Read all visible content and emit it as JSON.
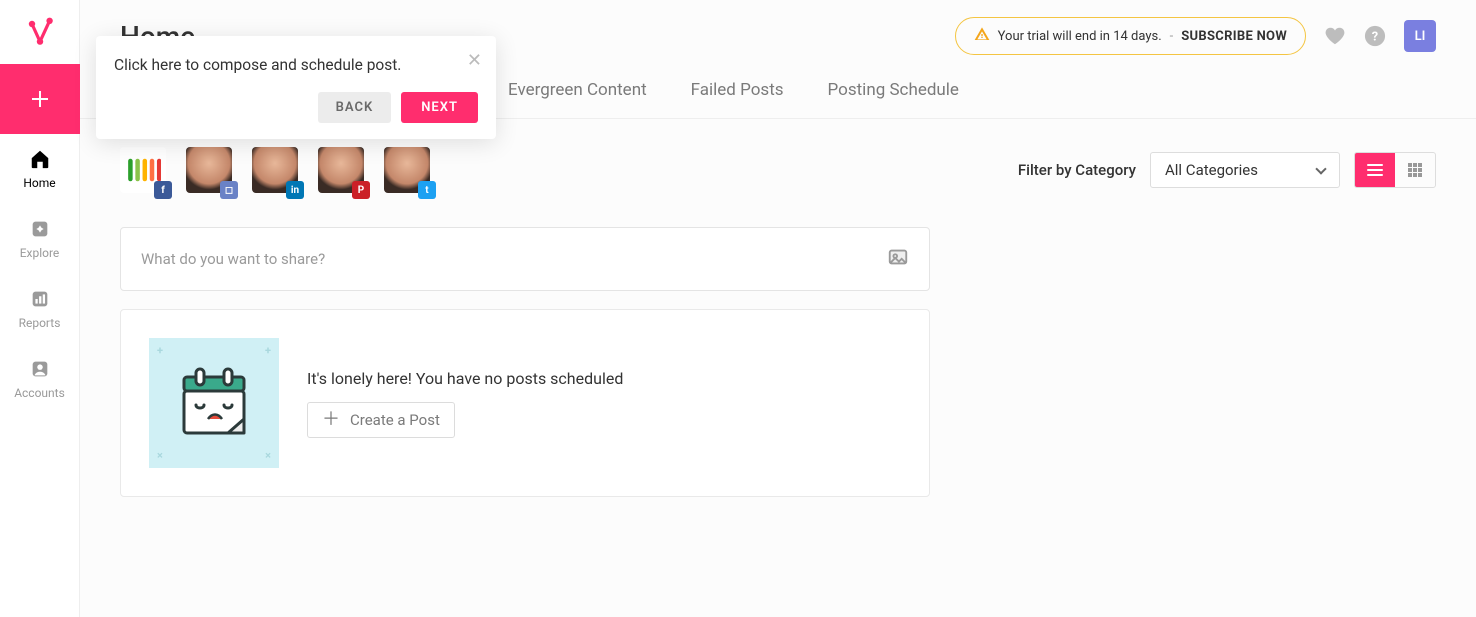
{
  "page_title": "Home",
  "sidebar": {
    "nav": [
      {
        "label": "Home"
      },
      {
        "label": "Explore"
      },
      {
        "label": "Reports"
      },
      {
        "label": "Accounts"
      }
    ]
  },
  "header": {
    "trial_text": "Your trial will end in 14 days.",
    "dash": "-",
    "subscribe": "SUBSCRIBE NOW",
    "avatar_initials": "LI"
  },
  "tabs": [
    {
      "label": "Evergreen Content"
    },
    {
      "label": "Failed Posts"
    },
    {
      "label": "Posting Schedule"
    }
  ],
  "accounts": [
    {
      "network": "blog"
    },
    {
      "network": "fb"
    },
    {
      "network": "ig"
    },
    {
      "network": "li"
    },
    {
      "network": "pin"
    },
    {
      "network": "tw"
    }
  ],
  "filter": {
    "label": "Filter by Category",
    "selected": "All Categories"
  },
  "compose": {
    "placeholder": "What do you want to share?"
  },
  "empty": {
    "message": "It's lonely here! You have no posts scheduled",
    "create_label": "Create a Post"
  },
  "tooltip": {
    "text": "Click here to compose and schedule post.",
    "back": "BACK",
    "next": "NEXT"
  }
}
